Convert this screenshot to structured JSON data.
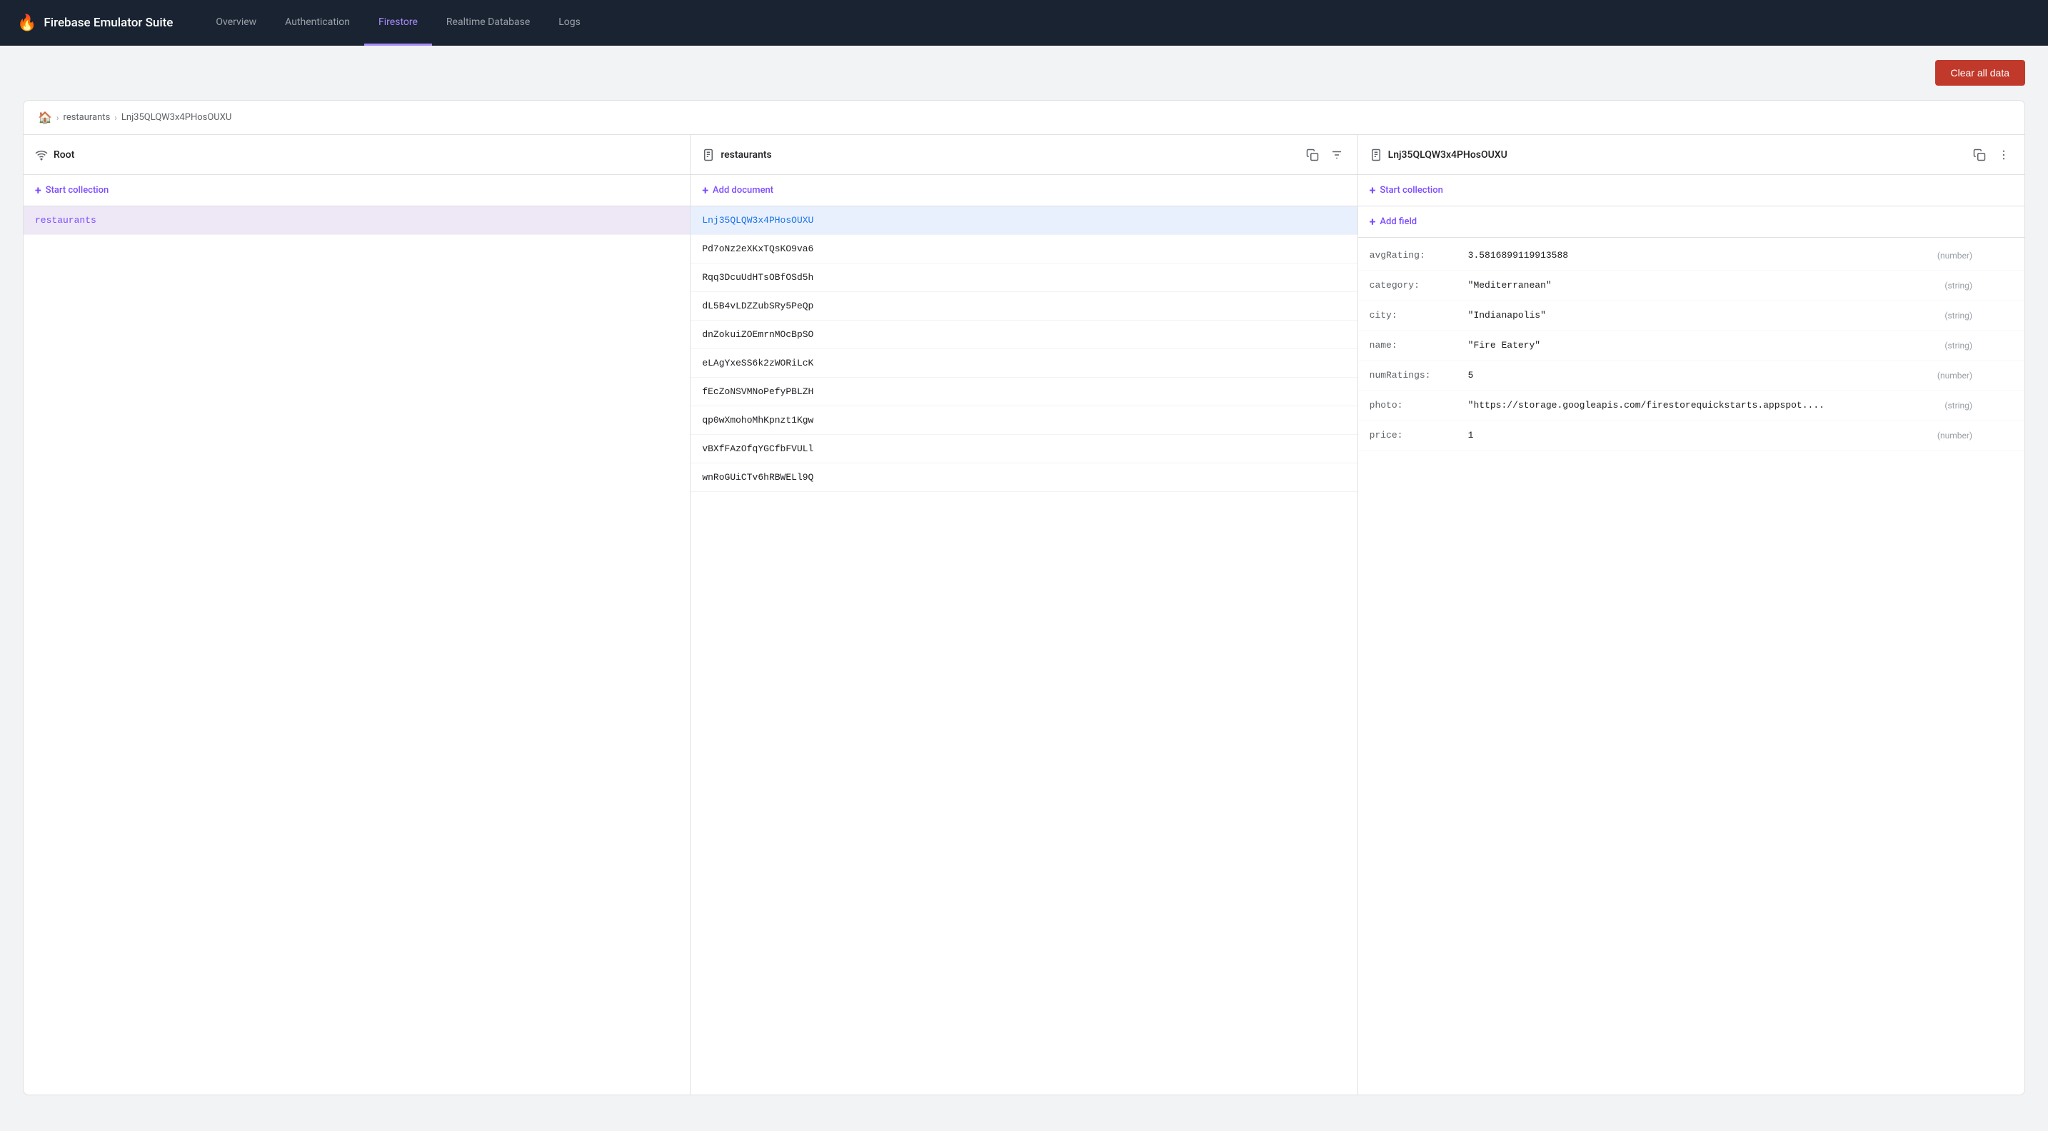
{
  "app": {
    "title": "Firebase Emulator Suite",
    "logo": "🔥"
  },
  "nav": {
    "tabs": [
      {
        "id": "overview",
        "label": "Overview",
        "active": false
      },
      {
        "id": "authentication",
        "label": "Authentication",
        "active": false
      },
      {
        "id": "firestore",
        "label": "Firestore",
        "active": true
      },
      {
        "id": "realtime-database",
        "label": "Realtime Database",
        "active": false
      },
      {
        "id": "logs",
        "label": "Logs",
        "active": false
      }
    ]
  },
  "toolbar": {
    "clear_data_label": "Clear all data"
  },
  "breadcrumb": {
    "home_icon": "🏠",
    "items": [
      {
        "label": "restaurants",
        "link": true
      },
      {
        "label": "Lnj35QLQW3x4PHosOUXU",
        "link": false
      }
    ]
  },
  "columns": {
    "root": {
      "title": "Root",
      "icon": "wifi",
      "start_collection_label": "Start collection",
      "items": [
        {
          "id": "restaurants",
          "label": "restaurants",
          "selected": true
        }
      ]
    },
    "restaurants": {
      "title": "restaurants",
      "icon": "doc",
      "add_document_label": "Add document",
      "items": [
        {
          "id": "1",
          "label": "Lnj35QLQW3x4PHosOUXU",
          "selected": true
        },
        {
          "id": "2",
          "label": "Pd7oNz2eXKxTQsKO9va6",
          "selected": false
        },
        {
          "id": "3",
          "label": "Rqq3DcuUdHTsOBfOSd5h",
          "selected": false
        },
        {
          "id": "4",
          "label": "dL5B4vLDZZubSRy5PeQp",
          "selected": false
        },
        {
          "id": "5",
          "label": "dnZokuiZOEmrnMOcBpSO",
          "selected": false
        },
        {
          "id": "6",
          "label": "eLAgYxeSS6k2zWORiLcK",
          "selected": false
        },
        {
          "id": "7",
          "label": "fEcZoNSVMNoPefyPBLZH",
          "selected": false
        },
        {
          "id": "8",
          "label": "qp0wXmohoMhKpnzt1Kgw",
          "selected": false
        },
        {
          "id": "9",
          "label": "vBXfFAzOfqYGCfbFVULl",
          "selected": false
        },
        {
          "id": "10",
          "label": "wnRoGUiCTv6hRBWELl9Q",
          "selected": false
        }
      ]
    },
    "document": {
      "title": "Lnj35QLQW3x4PHosOUXU",
      "icon": "doc",
      "start_collection_label": "Start collection",
      "add_field_label": "Add field",
      "fields": [
        {
          "key": "avgRating:",
          "value": "3.5816899119913588",
          "type": "(number)"
        },
        {
          "key": "category:",
          "value": "\"Mediterranean\"",
          "type": "(string)"
        },
        {
          "key": "city:",
          "value": "\"Indianapolis\"",
          "type": "(string)"
        },
        {
          "key": "name:",
          "value": "\"Fire Eatery\"",
          "type": "(string)"
        },
        {
          "key": "numRatings:",
          "value": "5",
          "type": "(number)"
        },
        {
          "key": "photo:",
          "value": "\"https://storage.googleapis.com/firestorequickstarts.appspot....",
          "type": "(string)"
        },
        {
          "key": "price:",
          "value": "1",
          "type": "(number)"
        }
      ]
    }
  }
}
